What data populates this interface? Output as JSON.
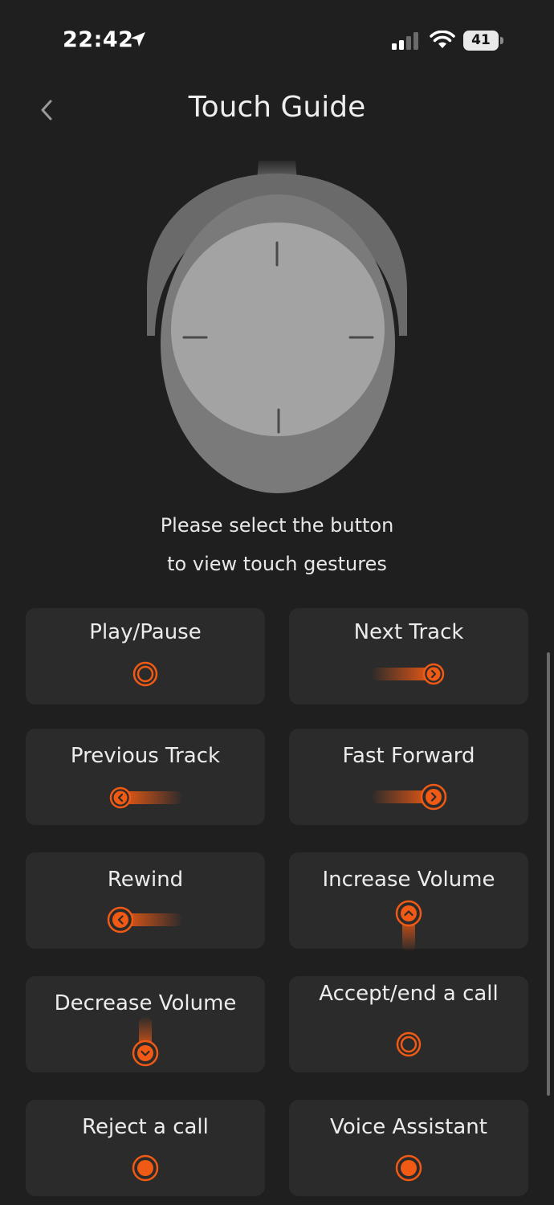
{
  "status_bar": {
    "time": "22:42",
    "battery": "41"
  },
  "header": {
    "title": "Touch Guide"
  },
  "instruction": {
    "line1": "Please select the button",
    "line2": "to view touch gestures"
  },
  "gestures": [
    {
      "label": "Play/Pause",
      "icon": "tap-icon"
    },
    {
      "label": "Next Track",
      "icon": "swipe-forward-icon"
    },
    {
      "label": "Previous Track",
      "icon": "swipe-back-icon"
    },
    {
      "label": "Fast Forward",
      "icon": "swipe-forward-hold-icon"
    },
    {
      "label": "Rewind",
      "icon": "swipe-back-hold-icon"
    },
    {
      "label": "Increase Volume",
      "icon": "swipe-up-icon"
    },
    {
      "label": "Decrease Volume",
      "icon": "swipe-down-icon"
    },
    {
      "label": "Accept/end a call",
      "icon": "tap-icon"
    },
    {
      "label": "Reject a call",
      "icon": "press-hold-icon"
    },
    {
      "label": "Voice Assistant",
      "icon": "press-hold-icon"
    }
  ],
  "colors": {
    "accent": "#f05a14",
    "background": "#1f1f1f",
    "card": "#2b2b2b"
  }
}
